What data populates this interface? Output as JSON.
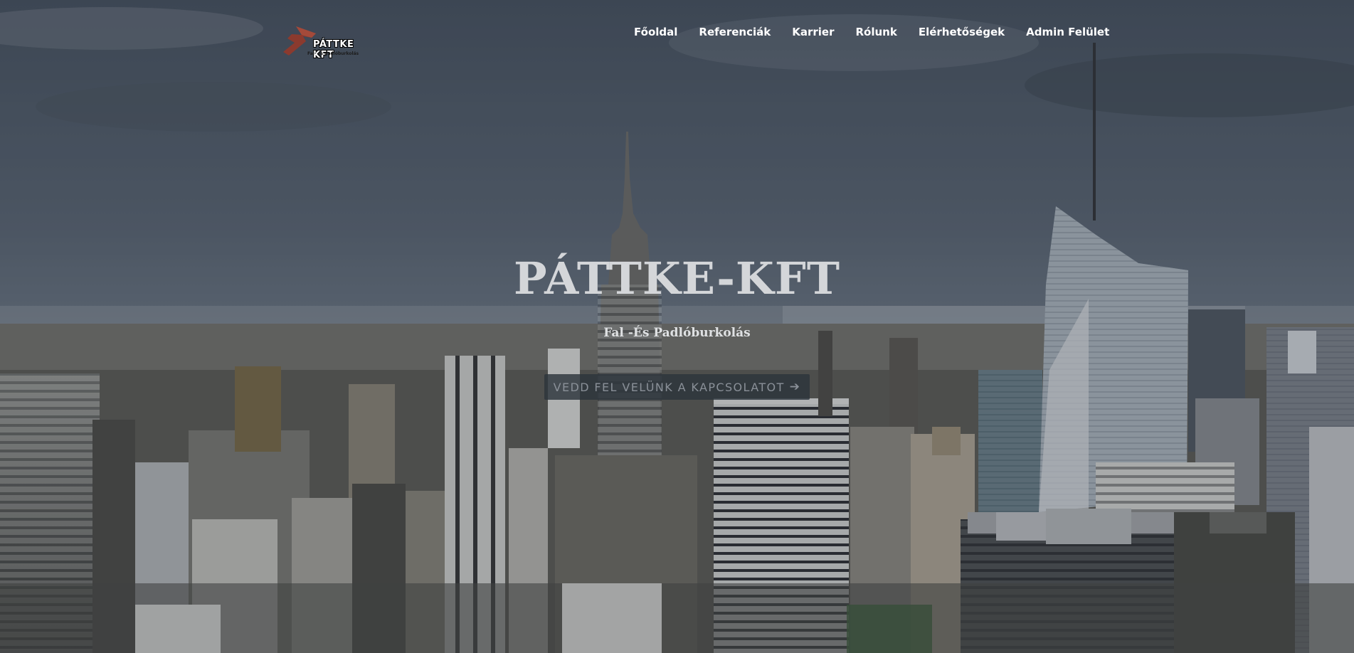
{
  "brand": {
    "name": "PÁTTKE KFT",
    "tagline": "Fal- és padlóburkolás",
    "accent_color": "#8b3a2e",
    "logo_icon": "arrow-chevron-icon"
  },
  "nav": {
    "items": [
      {
        "label": "Főoldal"
      },
      {
        "label": "Referenciák"
      },
      {
        "label": "Karrier"
      },
      {
        "label": "Rólunk"
      },
      {
        "label": "Elérhetőségek"
      },
      {
        "label": "Admin Felület"
      }
    ]
  },
  "hero": {
    "title": "PÁTTKE-KFT",
    "subtitle": "Fal -És Padlóburkolás",
    "cta_label": "VEDD FEL VELÜNK A KAPCSOLATOT",
    "cta_icon": "arrow-right-icon",
    "background": "city-skyline-image"
  }
}
